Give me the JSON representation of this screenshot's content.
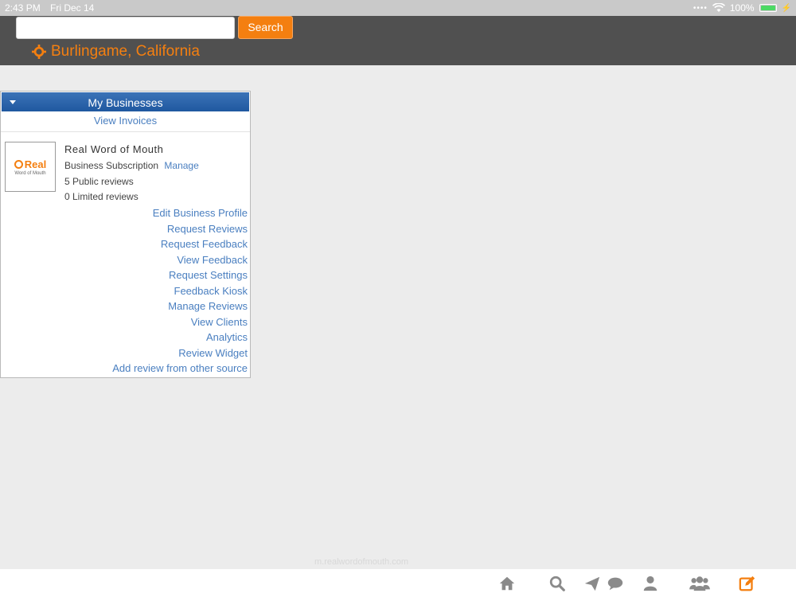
{
  "status_bar": {
    "time": "2:43 PM",
    "date": "Fri Dec 14",
    "battery": "100%"
  },
  "header": {
    "search_placeholder": "",
    "search_button": "Search",
    "location": "Burlingame, California"
  },
  "panel": {
    "title": "My Businesses",
    "view_invoices": "View Invoices",
    "business": {
      "logo_word": "Real",
      "logo_sub": "Word of Mouth",
      "name": "Real Word of Mouth",
      "subscription": "Business Subscription",
      "manage": "Manage",
      "public_reviews": "5 Public reviews",
      "limited_reviews": "0 Limited reviews"
    },
    "actions": [
      "Edit Business Profile",
      "Request Reviews",
      "Request Feedback",
      "View Feedback",
      "Request Settings",
      "Feedback Kiosk",
      "Manage Reviews",
      "View Clients",
      "Analytics",
      "Review Widget",
      "Add review from other source"
    ]
  },
  "bottom": {
    "url_text": "m.realwordofmouth.com"
  },
  "colors": {
    "accent": "#f47f10",
    "header_bg": "#505050",
    "panel_head": "#2a62a8",
    "link": "#4a7fc0",
    "active_icon": "#f47f10"
  },
  "bottom_nav": [
    "home-icon",
    "search-icon",
    "send-icon",
    "chat-icon",
    "user-icon",
    "group-icon",
    "edit-icon"
  ]
}
